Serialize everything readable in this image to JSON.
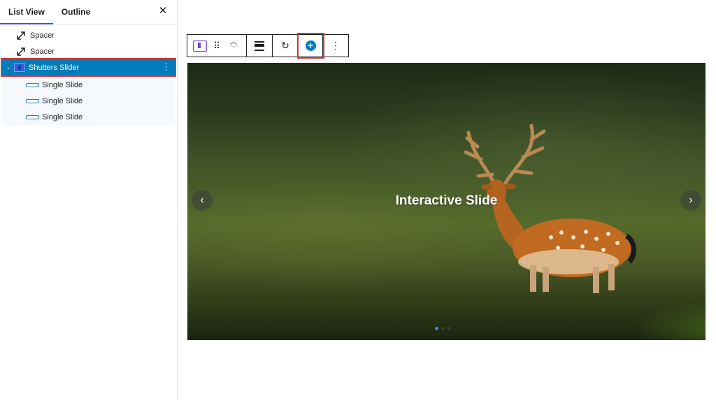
{
  "sidebar": {
    "tabs": [
      {
        "label": "List View",
        "active": true
      },
      {
        "label": "Outline",
        "active": false
      }
    ],
    "close_icon": "close-icon",
    "items": [
      {
        "label": "Spacer",
        "icon": "spacer-icon"
      },
      {
        "label": "Spacer",
        "icon": "spacer-icon"
      },
      {
        "label": "Shutters Slider",
        "icon": "slider-block-icon",
        "selected": true
      }
    ],
    "children": [
      {
        "label": "Single Slide",
        "icon": "slide-icon"
      },
      {
        "label": "Single Slide",
        "icon": "slide-icon"
      },
      {
        "label": "Single Slide",
        "icon": "slide-icon"
      }
    ]
  },
  "toolbar": {
    "buttons": [
      "block-type-icon",
      "drag-handle-icon",
      "move-up-down-icon",
      "align-icon",
      "rotate-icon",
      "add-slide-icon",
      "more-options-icon"
    ]
  },
  "slider": {
    "title": "Interactive Slide",
    "slides_count": 3,
    "active_slide": 1
  },
  "colors": {
    "accent": "#007cba",
    "highlight": "#d63638",
    "tab_underline": "#3858e9"
  }
}
